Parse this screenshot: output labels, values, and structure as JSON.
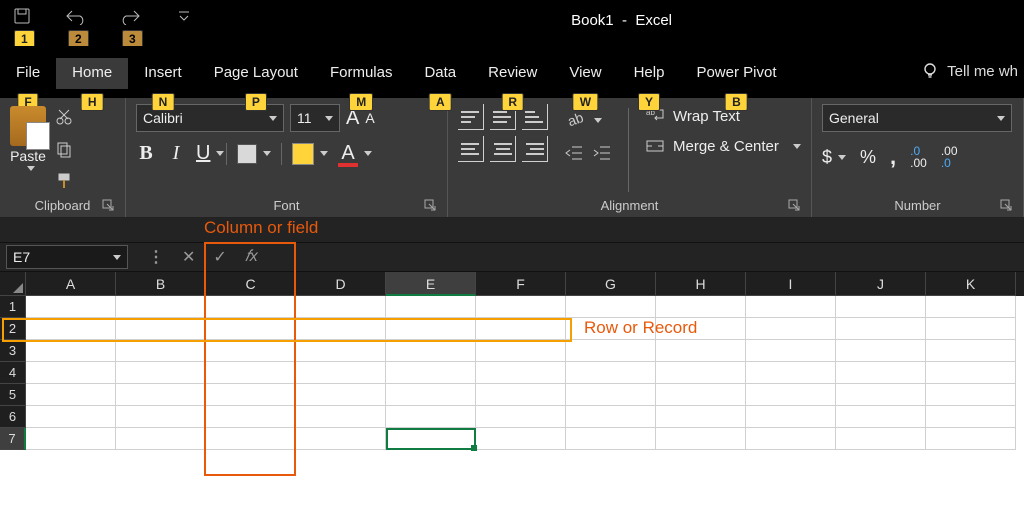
{
  "title": {
    "doc": "Book1",
    "app": "Excel"
  },
  "qat": {
    "k1": "1",
    "k2": "2",
    "k3": "3"
  },
  "tabs": {
    "file": {
      "label": "File",
      "key": "F"
    },
    "home": {
      "label": "Home",
      "key": "H"
    },
    "insert": {
      "label": "Insert",
      "key": "N"
    },
    "layout": {
      "label": "Page Layout",
      "key": "P"
    },
    "formulas": {
      "label": "Formulas",
      "key": "M"
    },
    "data": {
      "label": "Data",
      "key": "A"
    },
    "review": {
      "label": "Review",
      "key": "R"
    },
    "view": {
      "label": "View",
      "key": "W"
    },
    "help": {
      "label": "Help",
      "key": "Y"
    },
    "pivot": {
      "label": "Power Pivot",
      "key": "B"
    }
  },
  "tellme": "Tell me wh",
  "ribbon": {
    "clipboard": {
      "label": "Clipboard",
      "paste": "Paste"
    },
    "font": {
      "label": "Font",
      "name": "Calibri",
      "size": "11",
      "grow": "A",
      "shrink": "A",
      "bold": "B",
      "italic": "I",
      "underline": "U",
      "colorA": "A"
    },
    "alignment": {
      "label": "Alignment",
      "wrap": "Wrap Text",
      "merge": "Merge & Center"
    },
    "number": {
      "label": "Number",
      "format": "General",
      "currency": "$",
      "percent": "%",
      "comma": ",",
      "inc": ".0 .00",
      "dec": ".00 .0"
    }
  },
  "annotations": {
    "column": "Column or  field",
    "row": "Row or Record"
  },
  "namebox": "E7",
  "fx": "𝑓x",
  "columns": [
    "A",
    "B",
    "C",
    "D",
    "E",
    "F",
    "G",
    "H",
    "I",
    "J",
    "K"
  ],
  "rows": [
    "1",
    "2",
    "3",
    "4",
    "5",
    "6",
    "7"
  ]
}
